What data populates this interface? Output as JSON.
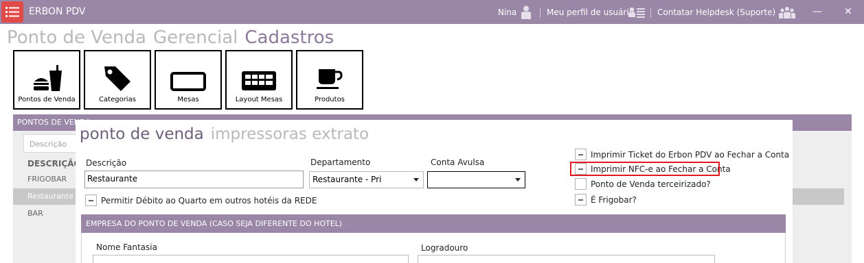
{
  "titlebar": {
    "app_name": "ERBON PDV",
    "user_name": "Nina",
    "profile_link": "Meu perfil de usuário",
    "helpdesk_link": "Contatar Helpdesk (Suporte)",
    "minimize": "—",
    "close": "✕"
  },
  "topnav": {
    "items": [
      "Ponto de Venda",
      "Gerencial",
      "Cadastros"
    ],
    "active": "Cadastros"
  },
  "toolbar": {
    "tiles": [
      {
        "label": "Pontos de Venda",
        "icon": "food-drink-icon"
      },
      {
        "label": "Categorias",
        "icon": "tag-icon"
      },
      {
        "label": "Mesas",
        "icon": "table-rect-icon"
      },
      {
        "label": "Layout Mesas",
        "icon": "grid-layout-icon"
      },
      {
        "label": "Produtos",
        "icon": "cup-icon"
      }
    ]
  },
  "list": {
    "header": "PONTOS DE VENDA",
    "search_placeholder": "Descrição",
    "column": "DESCRIÇÃO",
    "rows": [
      "FRIGOBAR",
      "Restaurante",
      "BAR"
    ],
    "selected": "Restaurante"
  },
  "form": {
    "tabs": [
      "ponto de venda",
      "impressoras extrato"
    ],
    "descricao_label": "Descrição",
    "descricao_value": "Restaurante",
    "departamento_label": "Departamento",
    "departamento_value": "Restaurante - Pri",
    "conta_avulsa_label": "Conta Avulsa",
    "conta_avulsa_value": "",
    "permitir_debito_label": "Permitir Débito ao Quarto em outros hotéis da REDE",
    "checkboxes": [
      {
        "label": "Imprimir Ticket do Erbon PDV ao Fechar a Conta",
        "state": "indeterminate"
      },
      {
        "label": "Imprimir NFC-e ao Fechar a Conta",
        "state": "indeterminate",
        "highlighted": true
      },
      {
        "label": "Ponto de Venda terceirizado?",
        "state": "unchecked"
      },
      {
        "label": "É Frigobar?",
        "state": "indeterminate"
      }
    ],
    "empresa_section": "EMPRESA DO PONTO DE VENDA (CASO SEJA DIFERENTE DO HOTEL)",
    "nome_fantasia_label": "Nome Fantasia",
    "logradouro_label": "Logradouro"
  },
  "colors": {
    "accent": "#9a86a6",
    "menu_button": "#e04b47",
    "highlight": "#e0191e",
    "nav_active": "#8b7a9b",
    "nav_inactive": "#b9b9b9"
  }
}
